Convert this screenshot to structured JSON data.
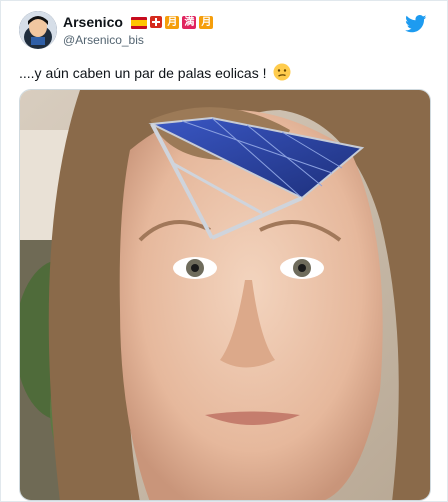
{
  "user": {
    "display_name": "Arsenico",
    "handle": "@Arsenico_bis",
    "badge_1": "月",
    "badge_2": "満",
    "badge_3": "月"
  },
  "tweet": {
    "text": "....y aún caben un par de palas eolicas !"
  },
  "icons": {
    "platform": "twitter-bird-icon",
    "emoji": "confused-face-emoji",
    "flag_1": "spain-flag-icon",
    "flag_2": "switzerland-flag-icon"
  },
  "colors": {
    "twitter_blue": "#1d9bf0",
    "badge_orange": "#f59e0b",
    "badge_red": "#e0245e"
  }
}
